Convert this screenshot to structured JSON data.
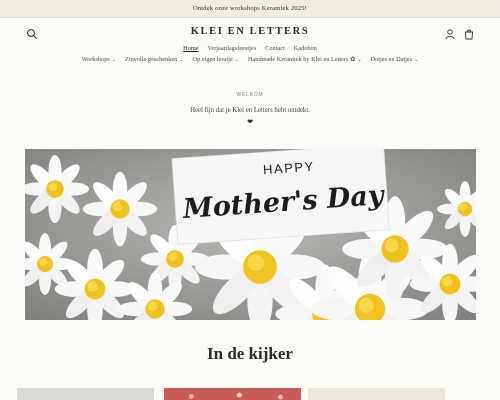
{
  "announcement": "Ontdek onze workshops Keramiek 2025!",
  "logo": "KLEI EN LETTERS",
  "nav_primary": [
    "Home",
    "Verjaardagsfeestjes",
    "Contact",
    "Kadobon"
  ],
  "nav_secondary": [
    "Workshops",
    "Zinvolle geschenken",
    "Op eigen houtje",
    "Handmade Keramiek by Klei en Letters ✿",
    "Dotjes en Datjes"
  ],
  "welcome": {
    "eyebrow": "WELKOM",
    "text": "Heel fijn dat je Klei en Letters hebt ontdekt.",
    "heart": "❤"
  },
  "hero": {
    "card_line1": "HAPPY",
    "card_line2": "Mother's Day"
  },
  "featured_title": "In de kijker",
  "icons": {
    "search": "search-icon",
    "account": "account-icon",
    "cart": "cart-icon"
  },
  "colors": {
    "announcement_bg": "#f1ece2",
    "page_bg": "#fdfbf8",
    "text": "#2b2b2b"
  }
}
